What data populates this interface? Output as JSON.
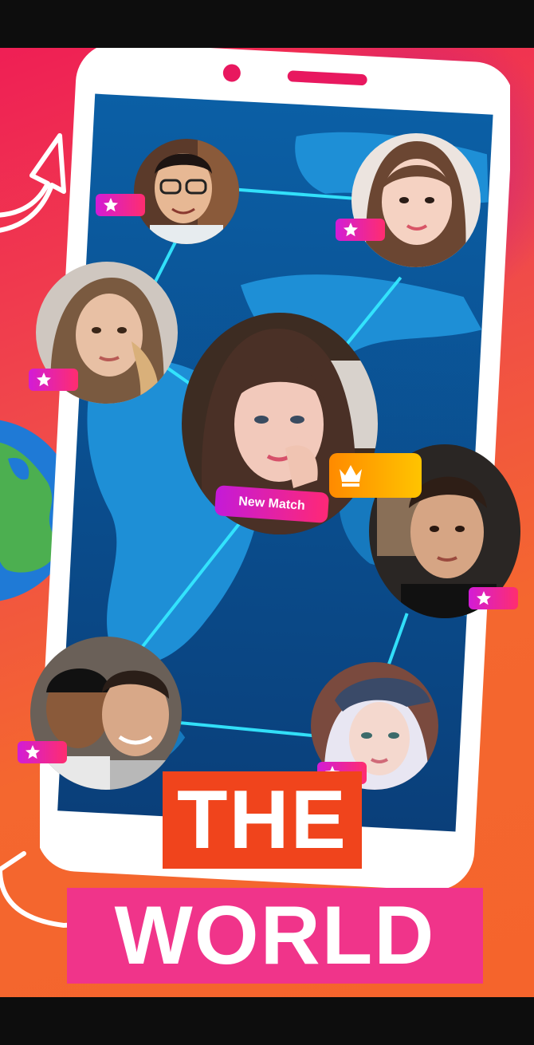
{
  "poster": {
    "new_match_label": "New Match",
    "headline_line1": "THE",
    "headline_line2": "WORLD"
  },
  "avatars": [
    {
      "name": "profile-man-glasses",
      "premium": false
    },
    {
      "name": "profile-woman-asian",
      "premium": false
    },
    {
      "name": "profile-woman-blonde",
      "premium": false
    },
    {
      "name": "profile-woman-center",
      "premium": false,
      "badge": "new-match"
    },
    {
      "name": "profile-man-dark-hair",
      "premium": true
    },
    {
      "name": "profile-two-men",
      "premium": false
    },
    {
      "name": "profile-woman-cap",
      "premium": false
    }
  ],
  "colors": {
    "accent_pink": "#f0348a",
    "accent_orange": "#f0441c",
    "map_blue": "#0a5a9c",
    "connection_cyan": "#35e8ff",
    "crown_gold": "#ffb000"
  },
  "icons": [
    "star-icon",
    "crown-icon",
    "globe-icon",
    "arrow-icon"
  ]
}
